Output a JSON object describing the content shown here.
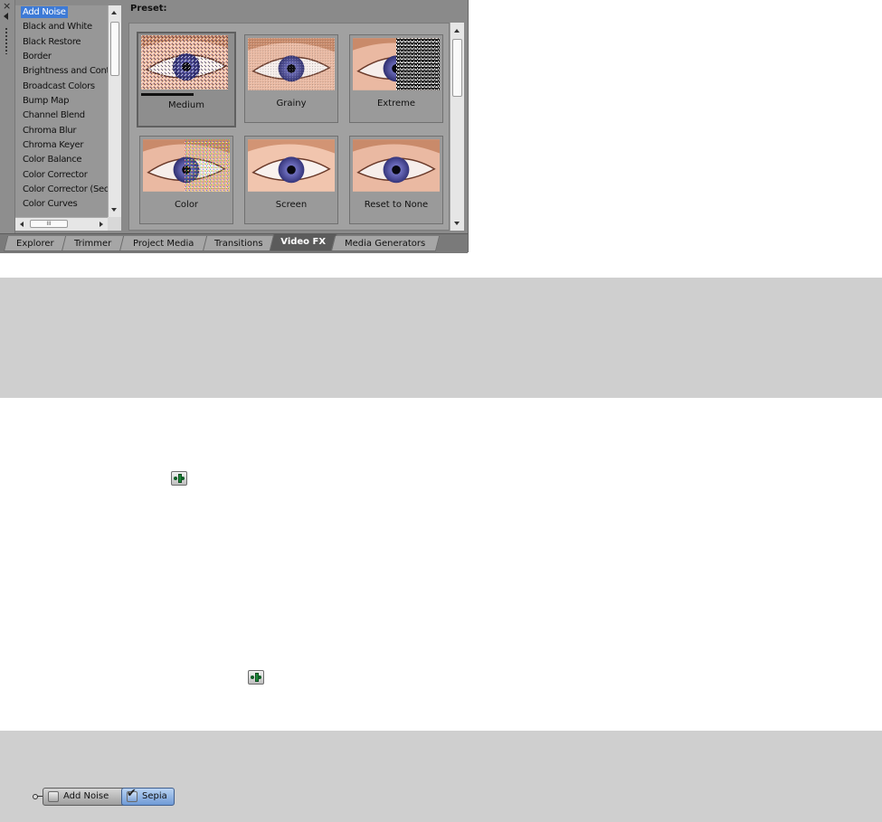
{
  "dock": {
    "close_icon": "×"
  },
  "fx_list": {
    "items": [
      "Add Noise",
      "Black and White",
      "Black Restore",
      "Border",
      "Brightness and Cont",
      "Broadcast Colors",
      "Bump Map",
      "Channel Blend",
      "Chroma Blur",
      "Chroma Keyer",
      "Color Balance",
      "Color Corrector",
      "Color Corrector (Sec",
      "Color Curves"
    ],
    "selected": "Add Noise",
    "hscroll_thumb": "III"
  },
  "preset": {
    "label": "Preset:",
    "tiles": [
      "Medium",
      "Grainy",
      "Extreme",
      "Color",
      "Screen",
      "Reset to None"
    ],
    "active": "Medium"
  },
  "tabs": [
    "Explorer",
    "Trimmer",
    "Project Media",
    "Transitions",
    "Video FX",
    "Media Generators"
  ],
  "active_tab": "Video FX",
  "chain": {
    "plugins": [
      {
        "label": "Add Noise",
        "enabled": false
      },
      {
        "label": "Sepia",
        "enabled": true
      }
    ]
  },
  "colors": {
    "selection": "#3d7ad6",
    "panel": "#cfcfcf",
    "window": "#8a8a8a"
  }
}
